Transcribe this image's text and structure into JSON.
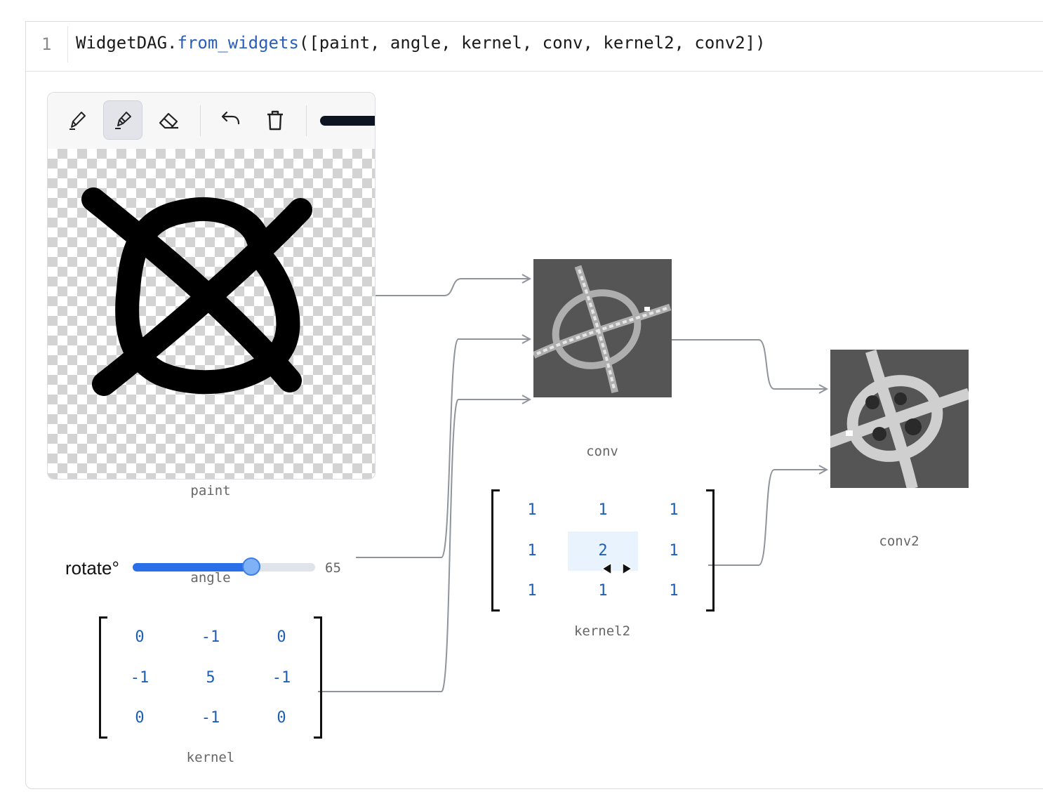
{
  "code": {
    "line_number": "1",
    "prefix": "WidgetDAG.",
    "function": "from_widgets",
    "args": "([paint, angle, kernel, conv, kernel2, conv2])"
  },
  "nodes": {
    "paint": {
      "caption": "paint",
      "tools": [
        "pencil-icon",
        "marker-icon",
        "eraser-icon",
        "undo-icon",
        "trash-icon"
      ],
      "active_tool": "marker-icon",
      "brush_color": "#0e1522"
    },
    "angle": {
      "caption": "angle",
      "label": "rotate°",
      "value": "65",
      "fraction": 0.65,
      "accent": "#2b6fe8"
    },
    "kernel": {
      "caption": "kernel",
      "rows": [
        [
          "0",
          "-1",
          "0"
        ],
        [
          "-1",
          "5",
          "-1"
        ],
        [
          "0",
          "-1",
          "0"
        ]
      ]
    },
    "conv": {
      "caption": "conv"
    },
    "kernel2": {
      "caption": "kernel2",
      "rows": [
        [
          "1",
          "1",
          "1"
        ],
        [
          "1",
          "2",
          "1"
        ],
        [
          "1",
          "1",
          "1"
        ]
      ],
      "highlighted": [
        1,
        1
      ]
    },
    "conv2": {
      "caption": "conv2"
    }
  },
  "colors": {
    "wire": "#8f949c",
    "value_text": "#1f5fb3",
    "image_bg": "#555555"
  }
}
